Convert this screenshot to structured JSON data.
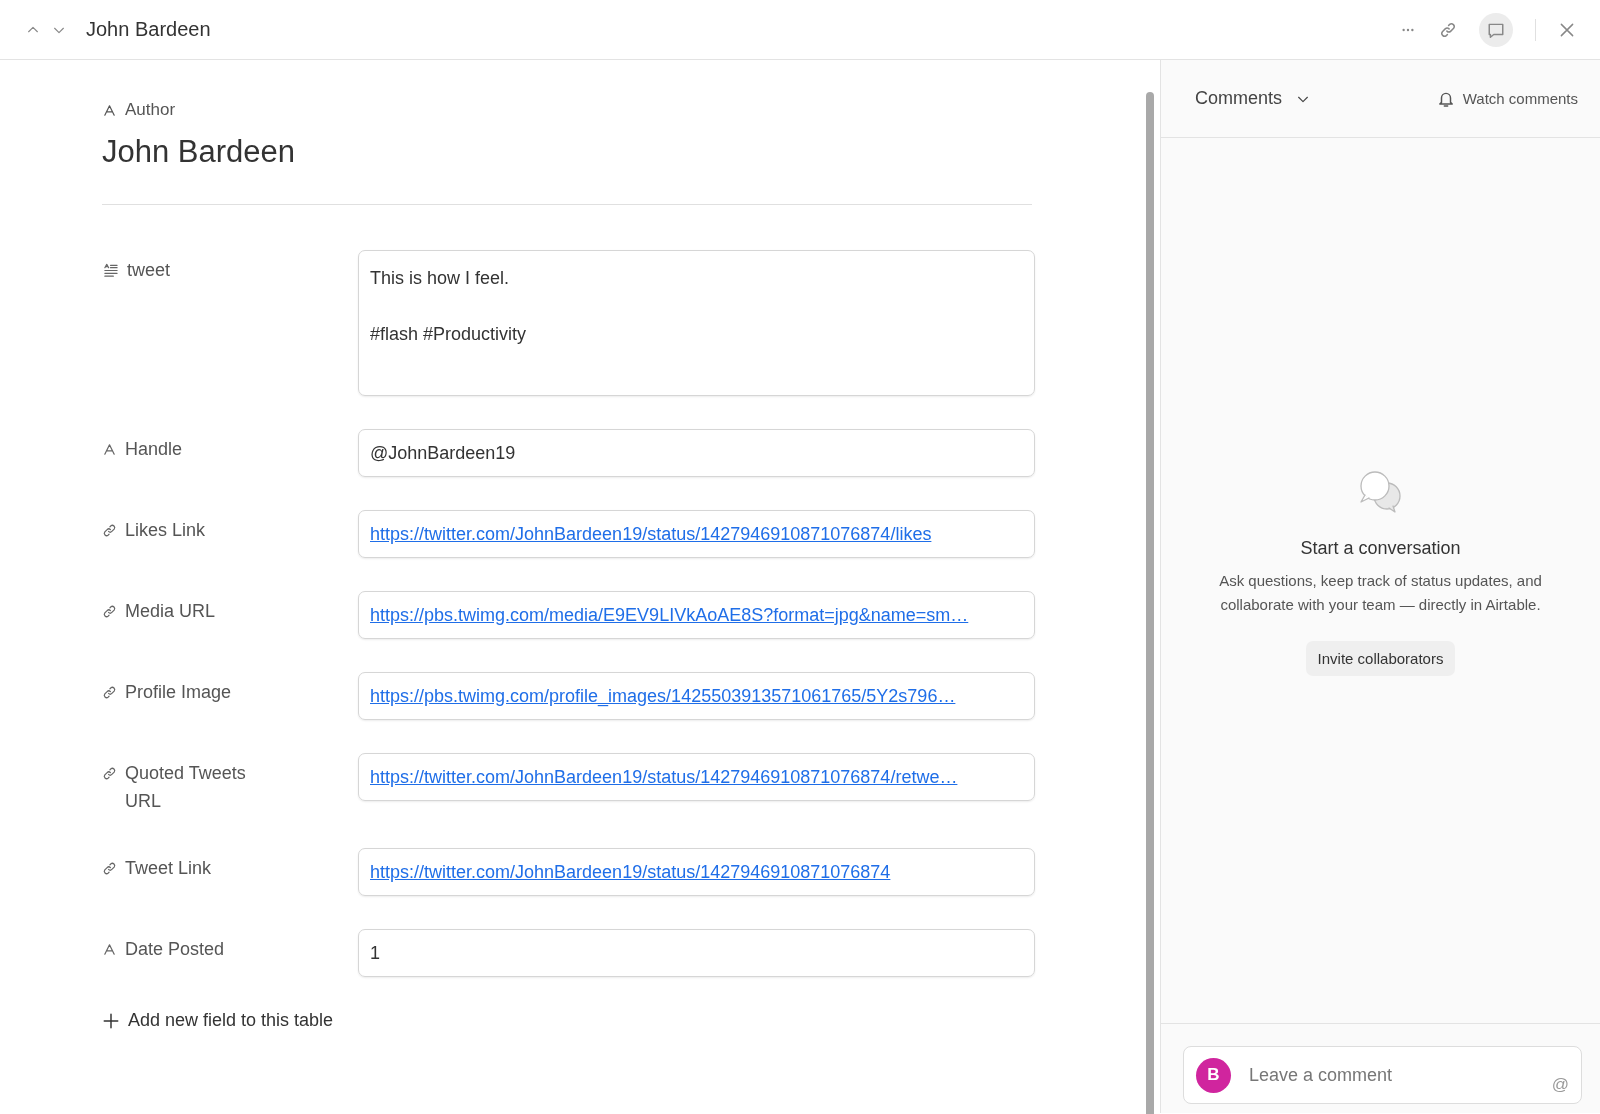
{
  "header": {
    "title": "John Bardeen"
  },
  "record": {
    "primary_field": {
      "kind": "text",
      "label": "Author"
    },
    "title": "John Bardeen"
  },
  "fields": [
    {
      "kind": "long_text",
      "label": "tweet",
      "lines": [
        "This is how I feel.",
        "#flash #Productivity"
      ]
    },
    {
      "kind": "text",
      "label": "Handle",
      "value": "@JohnBardeen19"
    },
    {
      "kind": "url",
      "label": "Likes Link",
      "value": "https://twitter.com/JohnBardeen19/status/1427946910871076874/likes"
    },
    {
      "kind": "url",
      "label": "Media URL",
      "value": "https://pbs.twimg.com/media/E9EV9LIVkAoAE8S?format=jpg&name=sm…"
    },
    {
      "kind": "url",
      "label": "Profile Image",
      "value": "https://pbs.twimg.com/profile_images/1425503913571061765/5Y2s796…"
    },
    {
      "kind": "url",
      "label": "Quoted Tweets URL",
      "value": "https://twitter.com/JohnBardeen19/status/1427946910871076874/retwe…"
    },
    {
      "kind": "url",
      "label": "Tweet Link",
      "value": "https://twitter.com/JohnBardeen19/status/1427946910871076874"
    },
    {
      "kind": "text",
      "label": "Date Posted",
      "value": "1"
    }
  ],
  "add_field": {
    "label": "Add new field to this table"
  },
  "comments": {
    "title": "Comments",
    "watch": "Watch comments",
    "empty_title": "Start a conversation",
    "empty_text": "Ask questions, keep track of status updates, and collaborate with your team — directly in Airtable.",
    "invite": "Invite collaborators",
    "avatar": {
      "initial": "B",
      "color": "#d0259e"
    },
    "placeholder": "Leave a comment",
    "mention": "@"
  }
}
